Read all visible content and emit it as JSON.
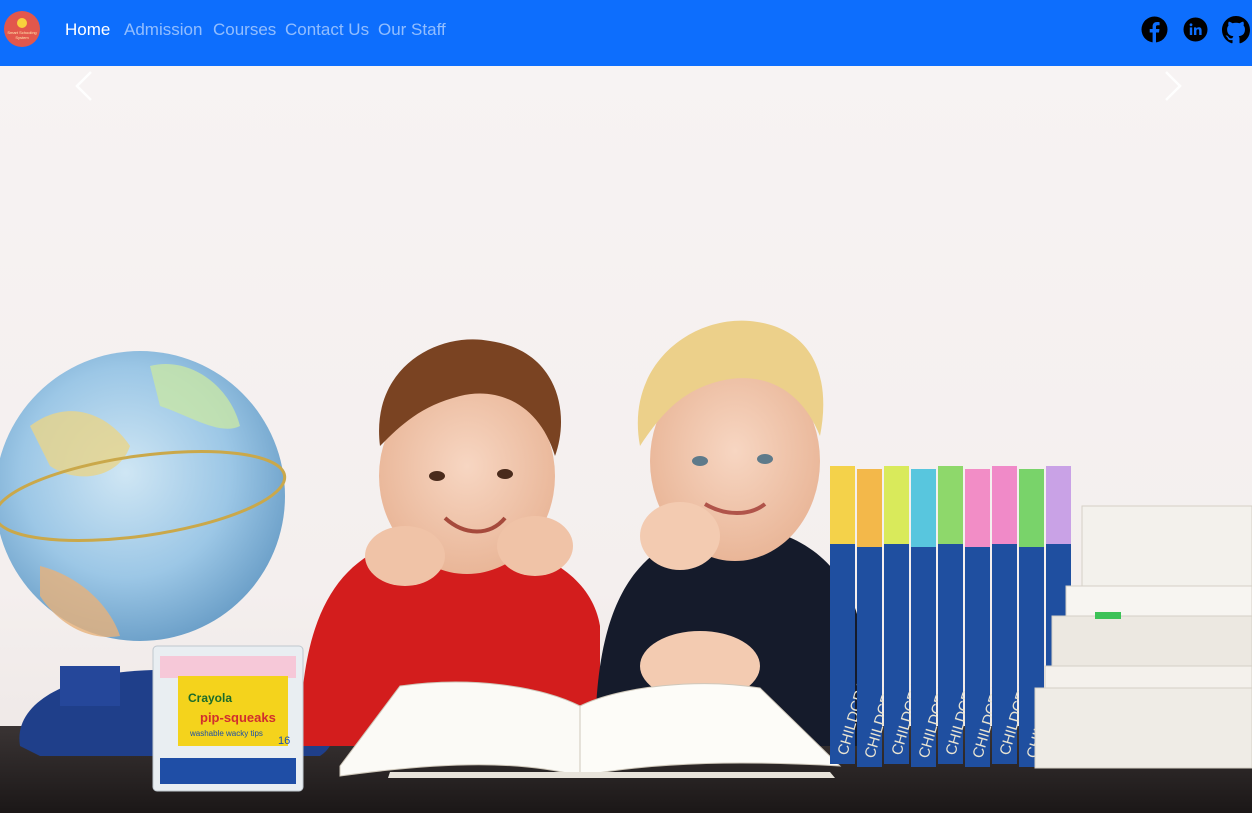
{
  "navbar": {
    "background": "#0d6efd",
    "logo": {
      "name": "school-logo",
      "brand_text": "Smart Schooling System"
    },
    "links": [
      {
        "label": "Home",
        "active": true
      },
      {
        "label": "Admission",
        "active": false
      },
      {
        "label": "Courses",
        "active": false
      },
      {
        "label": "Contact Us",
        "active": false
      },
      {
        "label": "Our Staff",
        "active": false
      }
    ],
    "social_icons": [
      "facebook-icon",
      "linkedin-icon",
      "github-icon"
    ]
  },
  "carousel": {
    "image": "children-at-desk-with-globe-and-books",
    "controls": {
      "prev_icon": "chevron-left-icon",
      "next_icon": "chevron-right-icon"
    },
    "book_spine_text": "CHILDCRAFT",
    "marker_box_text": {
      "brand": "Crayola",
      "product": "pip-squeaks",
      "sub": "washable wacky tips",
      "count": "16"
    }
  }
}
